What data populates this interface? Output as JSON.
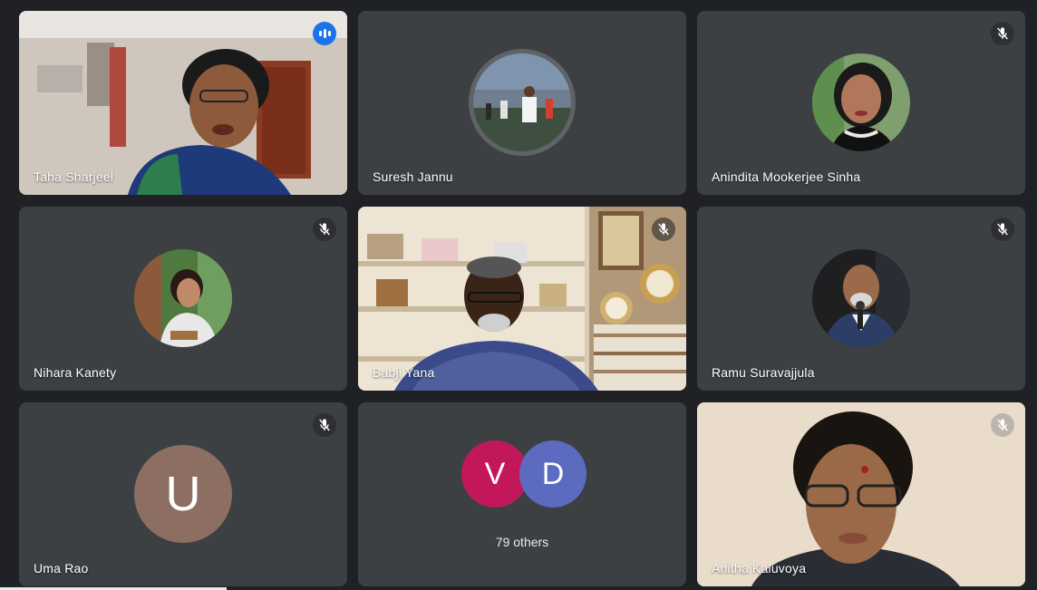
{
  "participants": [
    {
      "name": "Taha Sharjeel",
      "state": "speaking",
      "type": "video"
    },
    {
      "name": "Suresh Jannu",
      "state": "unmuted",
      "type": "photo-avatar"
    },
    {
      "name": "Anindita Mookerjee Sinha",
      "state": "muted",
      "type": "photo-avatar"
    },
    {
      "name": "Nihara Kanety",
      "state": "muted",
      "type": "photo-avatar"
    },
    {
      "name": "Babji Yana",
      "state": "muted",
      "type": "video"
    },
    {
      "name": "Ramu Suravajjula",
      "state": "muted",
      "type": "photo-avatar"
    },
    {
      "name": "Uma Rao",
      "state": "muted",
      "type": "letter-avatar",
      "initial": "U",
      "color": "#8d6e63"
    },
    {
      "name": "Anitha Kaluvoya",
      "state": "muted",
      "type": "video"
    }
  ],
  "others_tile": {
    "avatars": [
      {
        "initial": "V",
        "color": "#c2185b"
      },
      {
        "initial": "D",
        "color": "#5c6bc0"
      }
    ],
    "label": "79 others"
  },
  "icons": {
    "mute": "mic-off-icon",
    "speaking": "audio-level-icon"
  },
  "colors": {
    "background": "#202124",
    "tile": "#3c4043",
    "speaking_border": "#8ab4f8",
    "speaking_badge": "#1a73e8"
  }
}
